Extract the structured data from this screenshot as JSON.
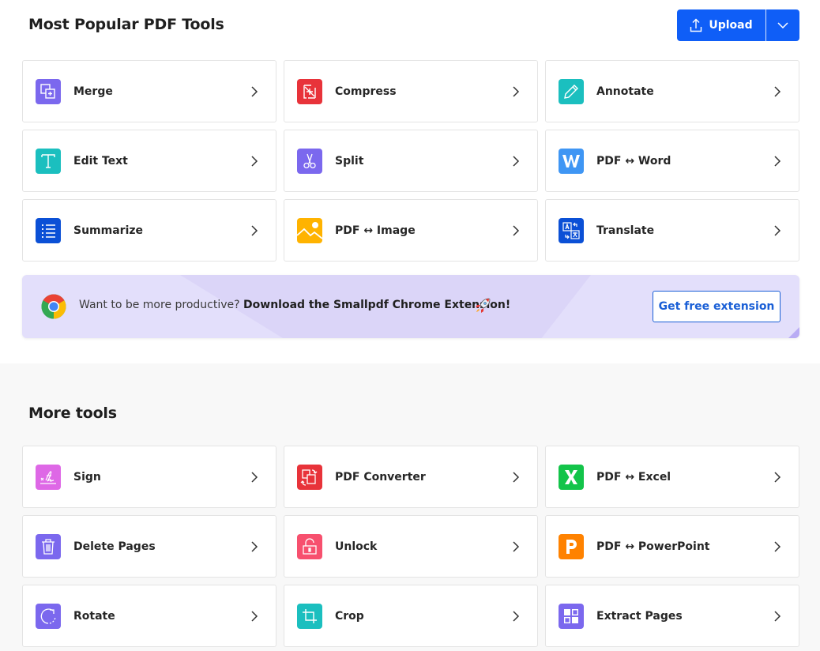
{
  "popular": {
    "title": "Most Popular PDF Tools",
    "upload": {
      "label": "Upload",
      "icon": "upload-icon",
      "dropdown_icon": "chevron-down-icon"
    },
    "tools": [
      {
        "label": "Merge",
        "icon": "merge-icon",
        "color": "#7b68ee"
      },
      {
        "label": "Compress",
        "icon": "compress-icon",
        "color": "#e8333a"
      },
      {
        "label": "Annotate",
        "icon": "pencil-icon",
        "color": "#1bbfbf"
      },
      {
        "label": "Edit Text",
        "icon": "text-icon",
        "color": "#1bbfbf"
      },
      {
        "label": "Split",
        "icon": "scissors-icon",
        "color": "#7b68ee"
      },
      {
        "label": "PDF ↔ Word",
        "icon": "word-icon",
        "color": "#3f96f4"
      },
      {
        "label": "Summarize",
        "icon": "list-icon",
        "color": "#0b50d6"
      },
      {
        "label": "PDF ↔ Image",
        "icon": "image-icon",
        "color": "#ffb300"
      },
      {
        "label": "Translate",
        "icon": "translate-icon",
        "color": "#0b50d6"
      }
    ]
  },
  "promo": {
    "text_plain": "Want to be more productive? ",
    "text_bold": "Download the Smallpdf Chrome Extension!",
    "button_label": "Get free extension",
    "icon": "chrome-icon",
    "emoji_icon": "rocket-icon"
  },
  "more": {
    "title": "More tools",
    "tools": [
      {
        "label": "Sign",
        "icon": "signature-icon",
        "color": "#de68e6"
      },
      {
        "label": "PDF Converter",
        "icon": "convert-icon",
        "color": "#e8333a"
      },
      {
        "label": "PDF ↔ Excel",
        "icon": "excel-icon",
        "color": "#13c44a"
      },
      {
        "label": "Delete Pages",
        "icon": "trash-icon",
        "color": "#7b68ee"
      },
      {
        "label": "Unlock",
        "icon": "unlock-icon",
        "color": "#f7506e"
      },
      {
        "label": "PDF ↔ PowerPoint",
        "icon": "powerpoint-icon",
        "color": "#ff8200"
      },
      {
        "label": "Rotate",
        "icon": "rotate-icon",
        "color": "#7b68ee"
      },
      {
        "label": "Crop",
        "icon": "crop-icon",
        "color": "#1bbfbf"
      },
      {
        "label": "Extract Pages",
        "icon": "extract-pages-icon",
        "color": "#7b68ee"
      }
    ]
  },
  "colors": {
    "primary": "#0f5ef7",
    "link": "#1a5fd6",
    "promo_bg": "#e3dffb"
  }
}
